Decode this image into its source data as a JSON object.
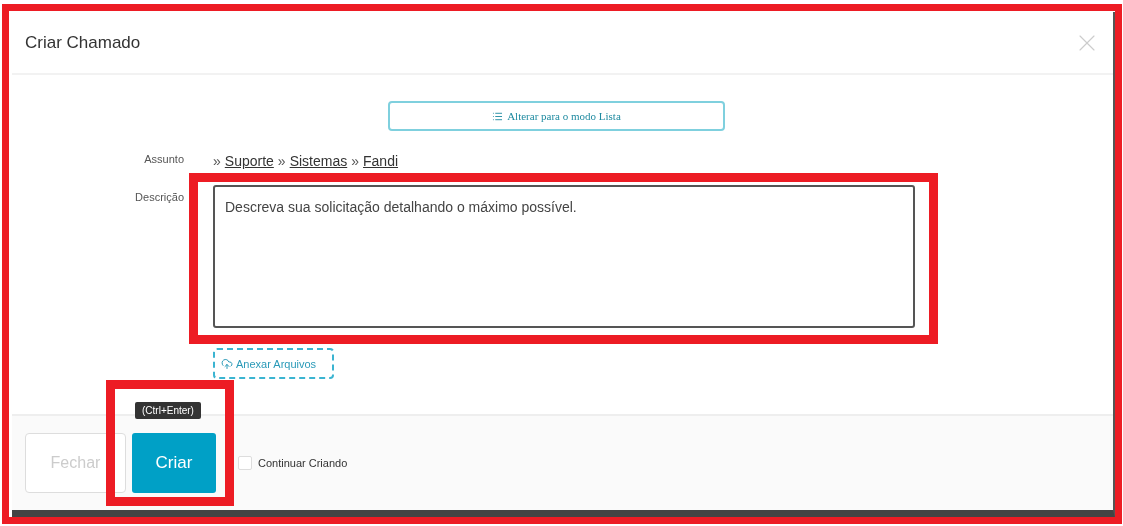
{
  "dialog": {
    "title": "Criar Chamado"
  },
  "mode_button": {
    "label": "Alterar para o modo Lista"
  },
  "subject": {
    "label": "Assunto",
    "path": [
      {
        "separator": "»",
        "label": "Suporte"
      },
      {
        "separator": "»",
        "label": "Sistemas"
      },
      {
        "separator": "»",
        "label": "Fandi"
      }
    ]
  },
  "description": {
    "label": "Descrição",
    "placeholder": "Descreva sua solicitação detalhando o máximo possível."
  },
  "attach_button": {
    "label": "Anexar Arquivos"
  },
  "footer": {
    "close_button": "Fechar",
    "create_button": "Criar",
    "tooltip": "(Ctrl+Enter)",
    "keep_creating": {
      "label": "Continuar Criando",
      "checked": false
    }
  }
}
